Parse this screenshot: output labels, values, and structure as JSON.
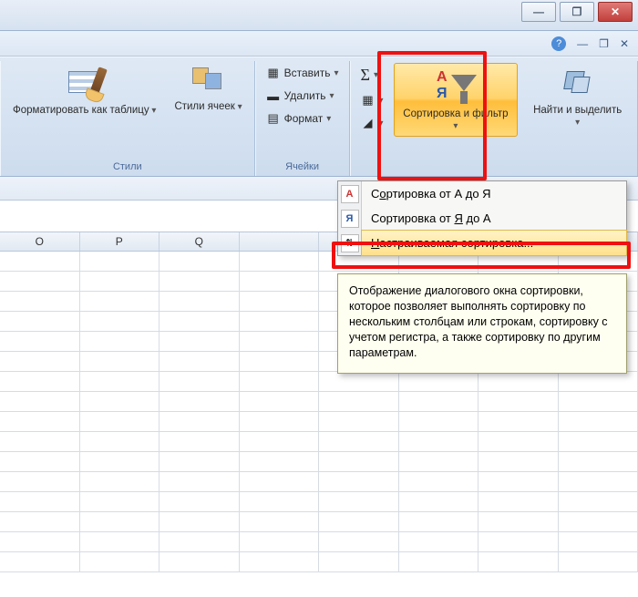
{
  "window": {
    "minimize": "—",
    "maximize": "❐",
    "close": "✕"
  },
  "toolbar": {
    "help": "?",
    "minribbon": "—",
    "restore": "❐",
    "x": "✕"
  },
  "ribbon": {
    "styles": {
      "label": "Стили",
      "format_as_table": "Форматировать\nкак таблицу",
      "cell_styles": "Стили\nячеек"
    },
    "cells": {
      "label": "Ячейки",
      "insert": "Вставить",
      "delete": "Удалить",
      "format": "Формат"
    },
    "editing": {
      "label": "",
      "autosum": "Σ",
      "fill": "▦",
      "clear": "◢",
      "sort_filter": "Сортировка\nи фильтр",
      "find_select": "Найти и\nвыделить"
    }
  },
  "dropdown": {
    "sort_az": "Сортировка от А до Я",
    "sort_za": "Сортировка от Я до А",
    "custom_sort": "Настраиваемая сортировка..."
  },
  "tooltip": {
    "text": "Отображение диалогового окна сортировки, которое позволяет выполнять сортировку по нескольким столбцам или строкам, сортировку с учетом регистра, а также сортировку по другим параметрам."
  },
  "columns": [
    "O",
    "P",
    "Q"
  ]
}
